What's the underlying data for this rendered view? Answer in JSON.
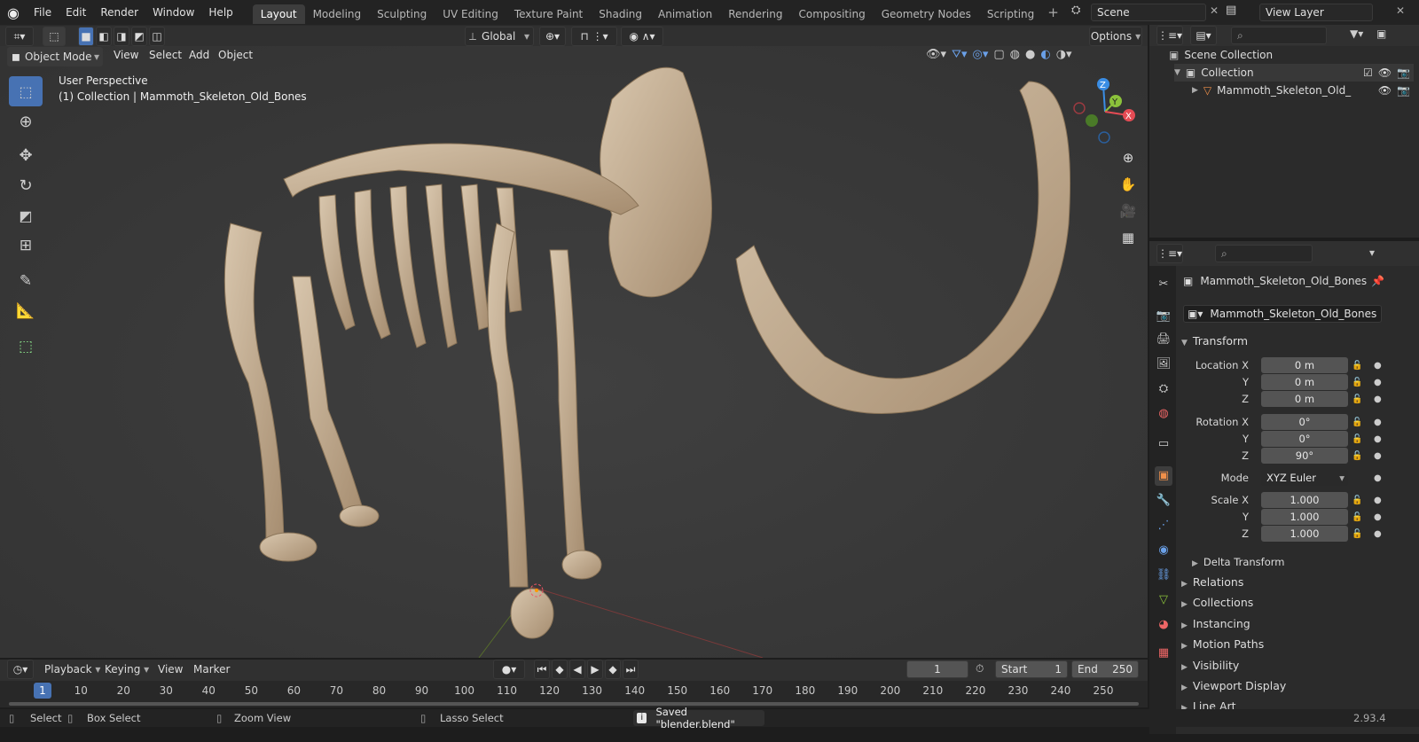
{
  "menus": [
    "File",
    "Edit",
    "Render",
    "Window",
    "Help"
  ],
  "workspaces": [
    "Layout",
    "Modeling",
    "Sculpting",
    "UV Editing",
    "Texture Paint",
    "Shading",
    "Animation",
    "Rendering",
    "Compositing",
    "Geometry Nodes",
    "Scripting"
  ],
  "active_workspace": "Layout",
  "scene_name": "Scene",
  "view_layer": "View Layer",
  "vp_header": {
    "orientation": "Global",
    "options": "Options"
  },
  "vp_header2": {
    "mode": "Object Mode",
    "view": "View",
    "select": "Select",
    "add": "Add",
    "object": "Object"
  },
  "overlay_text": {
    "line1": "User Perspective",
    "line2": "(1) Collection | Mammoth_Skeleton_Old_Bones"
  },
  "outliner": {
    "scene_collection": "Scene Collection",
    "collection": "Collection",
    "object": "Mammoth_Skeleton_Old_"
  },
  "properties": {
    "object_name": "Mammoth_Skeleton_Old_Bones",
    "object_field": "Mammoth_Skeleton_Old_Bones",
    "transform_header": "Transform",
    "location_label": "Location X",
    "loc_x": "0 m",
    "loc_y": "0 m",
    "loc_z": "0 m",
    "rotation_label": "Rotation X",
    "rot_x": "0°",
    "rot_y": "0°",
    "rot_z": "90°",
    "mode_label": "Mode",
    "mode_value": "XYZ Euler",
    "scale_label": "Scale X",
    "scale_x": "1.000",
    "scale_y": "1.000",
    "scale_z": "1.000",
    "y": "Y",
    "z": "Z",
    "delta": "Delta Transform",
    "panels": [
      "Relations",
      "Collections",
      "Instancing",
      "Motion Paths",
      "Visibility",
      "Viewport Display",
      "Line Art"
    ]
  },
  "timeline": {
    "playback": "Playback",
    "keying": "Keying",
    "view": "View",
    "marker": "Marker",
    "current_frame": "1",
    "start_label": "Start",
    "start": "1",
    "end_label": "End",
    "end": "250",
    "ticks": [
      "1",
      "10",
      "20",
      "30",
      "40",
      "50",
      "60",
      "70",
      "80",
      "90",
      "100",
      "110",
      "120",
      "130",
      "140",
      "150",
      "160",
      "170",
      "180",
      "190",
      "200",
      "210",
      "220",
      "230",
      "240",
      "250"
    ]
  },
  "status": {
    "select": "Select",
    "box_select": "Box Select",
    "zoom_view": "Zoom View",
    "lasso_select": "Lasso Select",
    "message": "Saved \"blender.blend\"",
    "version": "2.93.4"
  },
  "colors": {
    "accent": "#4772b3",
    "bone": "#c9b49a",
    "panel": "#2b2b2b",
    "viewport": "#3a3a3a",
    "axis_x": "#e54b54",
    "axis_y": "#8bc23b",
    "axis_z": "#3a8de4"
  }
}
